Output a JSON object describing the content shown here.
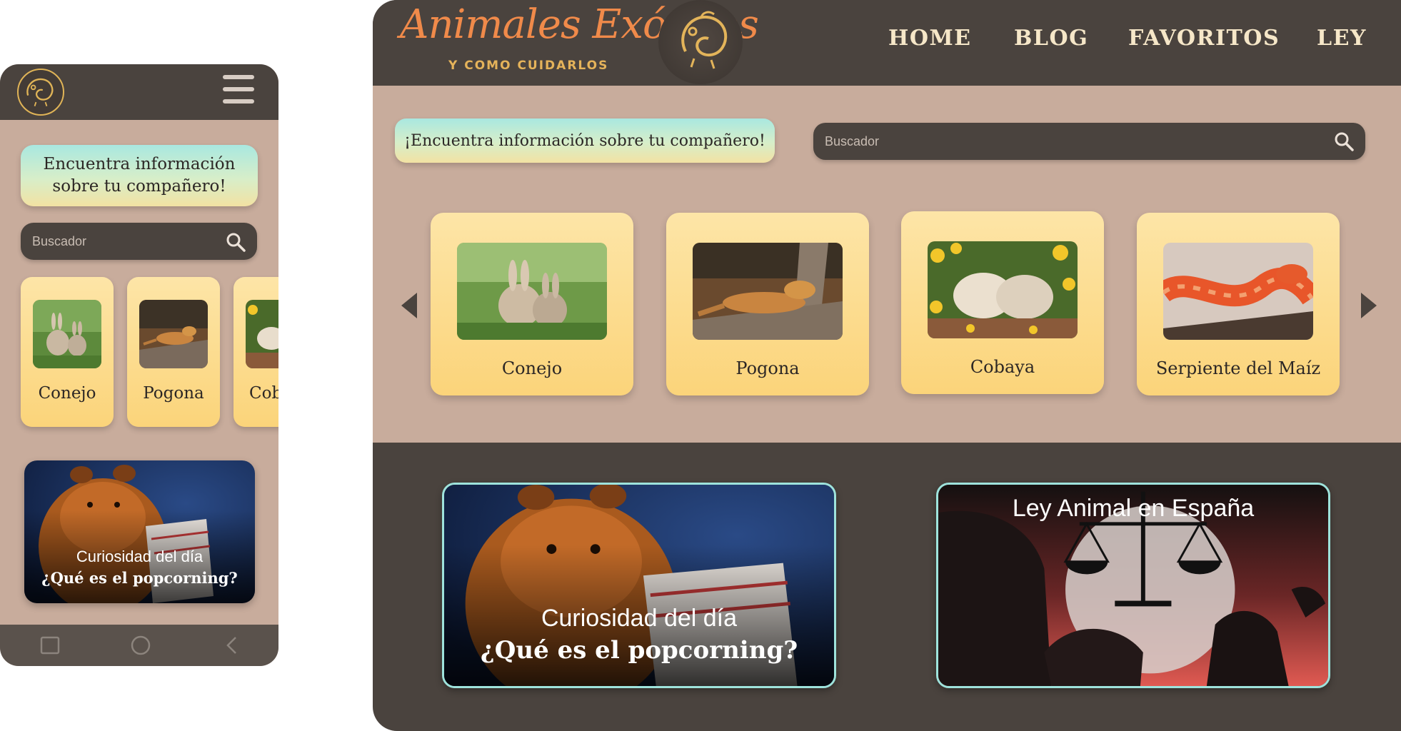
{
  "mobile": {
    "hero_text": "Encuentra información sobre tu compañero!",
    "search_placeholder": "Buscador",
    "cards": [
      {
        "label": "Conejo"
      },
      {
        "label": "Pogona"
      },
      {
        "label": "Cob"
      }
    ],
    "feature": {
      "line1": "Curiosidad del día",
      "line2": "¿Qué es el popcorning?"
    },
    "navbar": {
      "recent_icon": "square-icon",
      "home_icon": "circle-icon",
      "back_icon": "back-chevron-icon"
    }
  },
  "desktop": {
    "brand": {
      "title": "Animales Exóticos",
      "subtitle": "Y COMO CUIDARLOS"
    },
    "nav": [
      "HOME",
      "BLOG",
      "FAVORITOS",
      "LEY"
    ],
    "hero_text": "¡Encuentra información sobre tu compañero!",
    "search_placeholder": "Buscador",
    "cards": [
      {
        "label": "Conejo"
      },
      {
        "label": "Pogona"
      },
      {
        "label": "Cobaya"
      },
      {
        "label": "Serpiente del Maíz"
      }
    ],
    "feature_curiosity": {
      "line1": "Curiosidad del día",
      "line2": "¿Qué es el popcorning?"
    },
    "feature_law": {
      "title": "Ley Animal en España"
    }
  },
  "colors": {
    "dark_brown": "#4a433e",
    "beige_bg": "#c8ac9c",
    "card_yellow": "#fbd47a",
    "hero_mint": "#a9e8e0",
    "accent_gold": "#e5b35a",
    "brand_orange": "#f08a4a",
    "feature_border": "#9ee3dc"
  }
}
